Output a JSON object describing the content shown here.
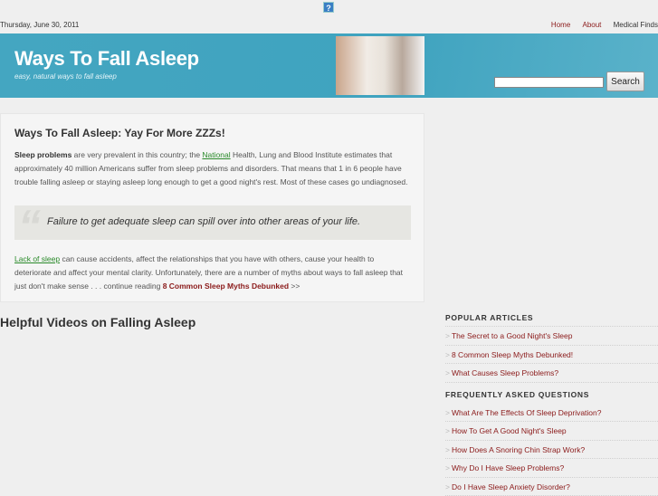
{
  "top": {
    "help_icon": "?",
    "date": "Thursday, June 30, 2011",
    "nav": [
      "Home",
      "About",
      "Medical Finds"
    ]
  },
  "header": {
    "title": "Ways To Fall Asleep",
    "tagline": "easy, natural ways to fall asleep",
    "search_value": "",
    "search_button": "Search",
    "brand_color": "#44a6c1"
  },
  "article": {
    "title": "Ways To Fall Asleep: Yay For More ZZZs!",
    "p1_bold": "Sleep problems",
    "p1_a": " are very prevalent in this country; the ",
    "p1_link": "National",
    "p1_b": " Health, Lung and Blood Institute estimates that approximately 40 million Americans suffer from sleep problems and disorders. That means that 1 in 6 people have trouble falling asleep or staying asleep long enough to get a good night's rest. Most of these cases go undiagnosed.",
    "quote": "Failure to get adequate sleep can spill over into other areas of your life.",
    "p2_link": "Lack of sleep",
    "p2_a": " can cause accidents, affect the relationships that you have with others, cause your health to deteriorate and affect your mental clarity. Unfortunately, there are a number of myths about ways to fall asleep that just don't make sense . . . continue reading ",
    "p2_red": "8 Common Sleep Myths Debunked",
    "p2_end": " >>"
  },
  "videos_heading": "Helpful Videos on Falling Asleep",
  "sidebar": {
    "popular": {
      "heading": "POPULAR ARTICLES",
      "items": [
        "The Secret to a Good Night's Sleep",
        "8 Common Sleep Myths Debunked!",
        "What Causes Sleep Problems?"
      ]
    },
    "faq": {
      "heading": "FREQUENTLY ASKED QUESTIONS",
      "items": [
        "What Are The Effects Of Sleep Deprivation?",
        "How To Get A Good Night's Sleep",
        "How Does A Snoring Chin Strap Work?",
        "Why Do I Have Sleep Problems?",
        "Do I Have Sleep Anxiety Disorder?"
      ]
    }
  }
}
